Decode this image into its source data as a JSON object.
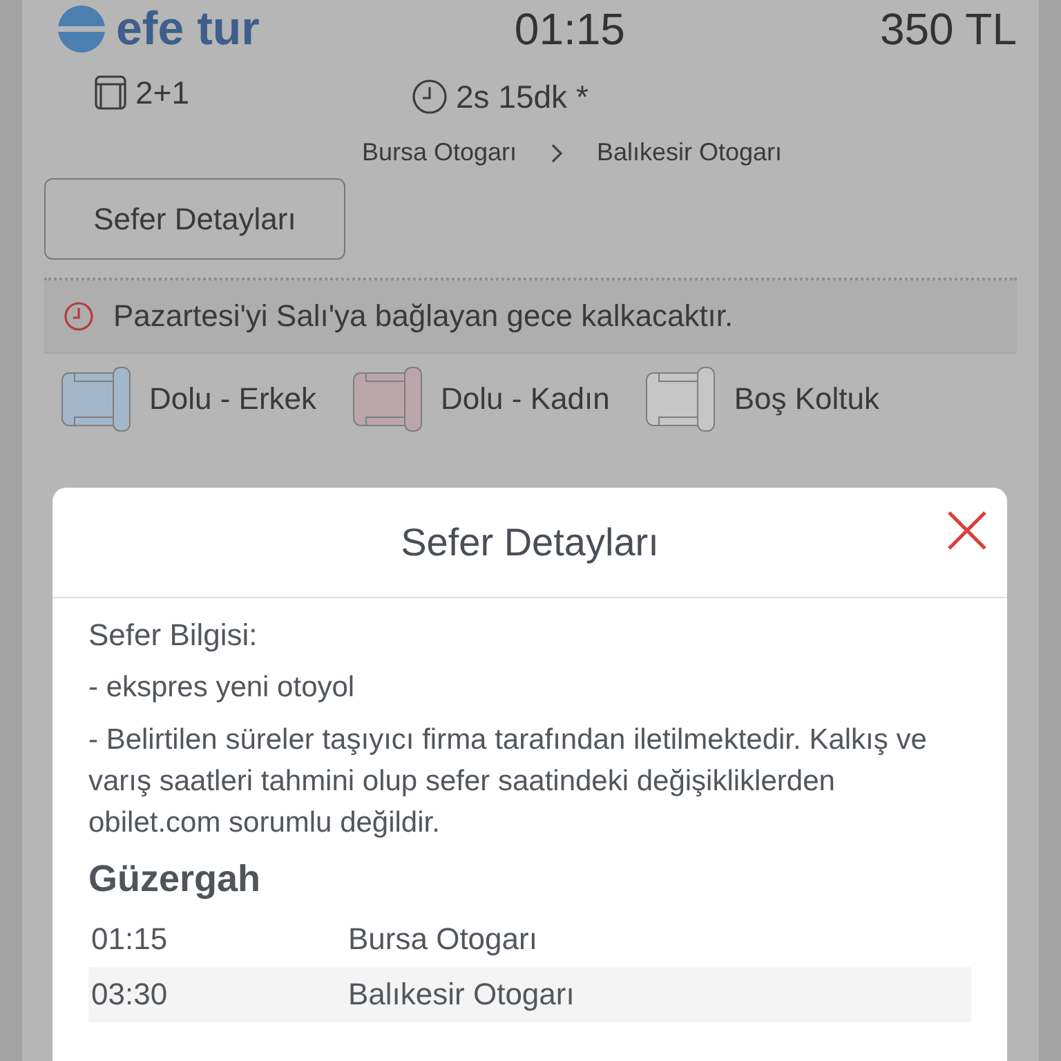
{
  "header": {
    "brand": "efe tur",
    "departure_time": "01:15",
    "price": "350 TL"
  },
  "features": [
    {
      "kind": "seat_layout",
      "text": "2+1"
    },
    {
      "kind": "duration",
      "text": "2s 15dk *"
    }
  ],
  "route": {
    "from": "Bursa Otogarı",
    "to": "Balıkesir Otogarı"
  },
  "details_button": "Sefer Detayları",
  "notice": "Pazartesi'yi Salı'ya bağlayan gece kalkacaktır.",
  "legend": [
    {
      "label": "Dolu - Erkek",
      "color": "#a4b6c9"
    },
    {
      "label": "Dolu - Kadın",
      "color": "#baa6ab"
    },
    {
      "label": "Boş Koltuk",
      "color": "#c6c6c6"
    }
  ],
  "modal": {
    "title": "Sefer Detayları",
    "info_heading": "Sefer Bilgisi:",
    "info_lines": [
      "- ekspres yeni otoyol",
      "- Belirtilen süreler taşıyıcı firma tarafından iletilmektedir. Kalkış ve varış saatleri tahmini olup sefer saatindeki değişikliklerden obilet.com sorumlu değildir."
    ],
    "route_heading": "Güzergah",
    "stops": [
      {
        "time": "01:15",
        "station": "Bursa Otogarı"
      },
      {
        "time": "03:30",
        "station": "Balıkesir Otogarı"
      }
    ]
  }
}
